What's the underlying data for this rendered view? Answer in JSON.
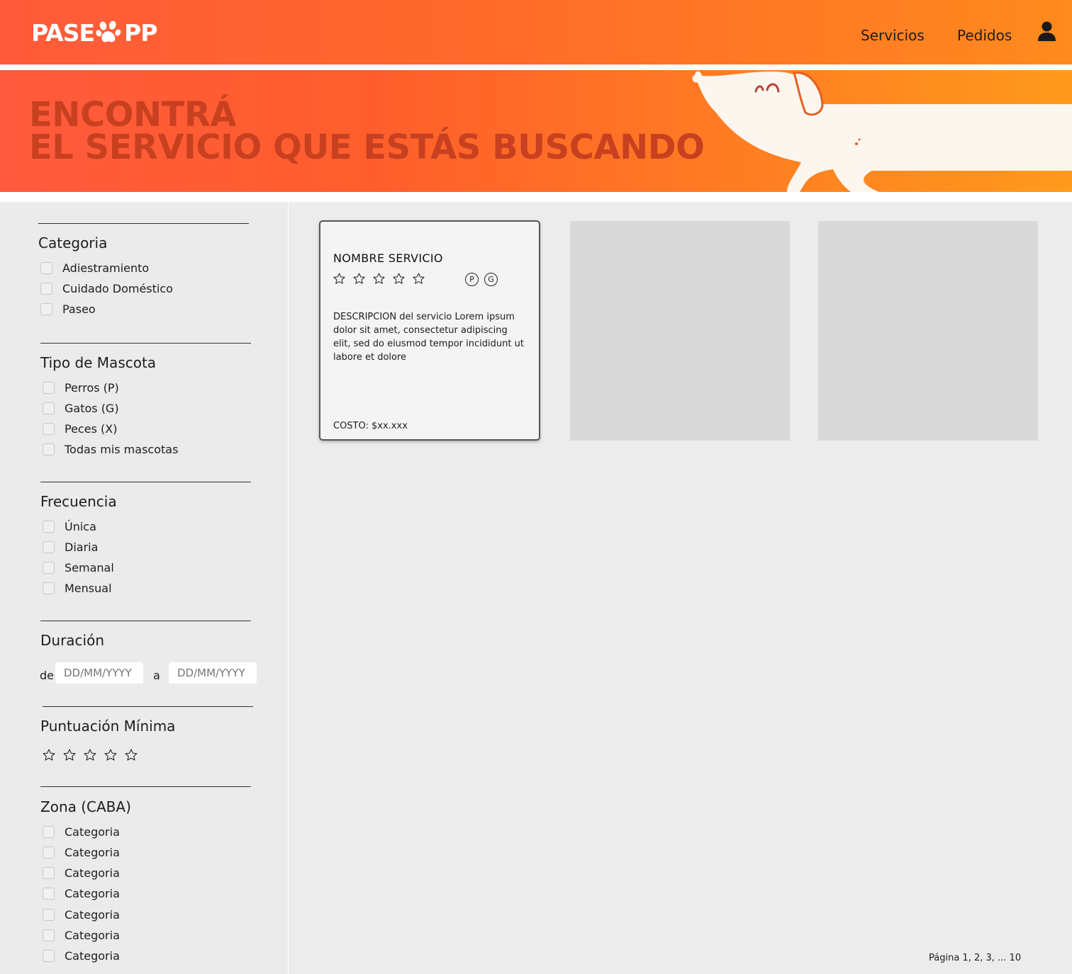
{
  "header": {
    "logo_text_left": "PASE",
    "logo_text_right": "PP",
    "nav": [
      "Servicios",
      "Pedidos"
    ]
  },
  "hero": {
    "title_line1": "ENCONTRÁ",
    "title_line2": "EL SERVICIO QUE ESTÁS BUSCANDO"
  },
  "filters": {
    "categoria": {
      "title": "Categoria",
      "options": [
        "Adiestramiento",
        "Cuidado Doméstico",
        "Paseo"
      ]
    },
    "mascota": {
      "title": "Tipo de Mascota",
      "options": [
        "Perros (P)",
        "Gatos (G)",
        "Peces (X)",
        "Todas mis mascotas"
      ]
    },
    "frecuencia": {
      "title": "Frecuencia",
      "options": [
        "Única",
        "Diaria",
        "Semanal",
        "Mensual"
      ]
    },
    "duracion": {
      "title": "Duración",
      "from_label": "de",
      "to_label": "a",
      "from_placeholder": "DD/MM/YYYY",
      "to_placeholder": "DD/MM/YYYY"
    },
    "puntuacion": {
      "title": "Puntuación Mínima",
      "stars": 5
    },
    "zona": {
      "title": "Zona (CABA)",
      "options": [
        "Categoria",
        "Categoria",
        "Categoria",
        "Categoria",
        "Categoria",
        "Categoria",
        "Categoria"
      ]
    }
  },
  "card": {
    "title": "NOMBRE SERVICIO",
    "stars": 5,
    "badges": [
      "P",
      "G"
    ],
    "description": "DESCRIPCION del servicio Lorem ipsum dolor sit amet, consectetur adipiscing elit, sed do eiusmod tempor incididunt ut labore et dolore",
    "cost": "COSTO: $xx.xxx"
  },
  "pagination": "Página 1, 2, 3, ... 10",
  "colors": {
    "brand_orange": "#ff6a2a",
    "hero_text": "#c7401f",
    "card_border": "#555555",
    "placeholder": "#d9d9d9"
  },
  "icons": {
    "user": "user-icon",
    "paw": "paw-icon",
    "star": "star-outline-icon"
  }
}
